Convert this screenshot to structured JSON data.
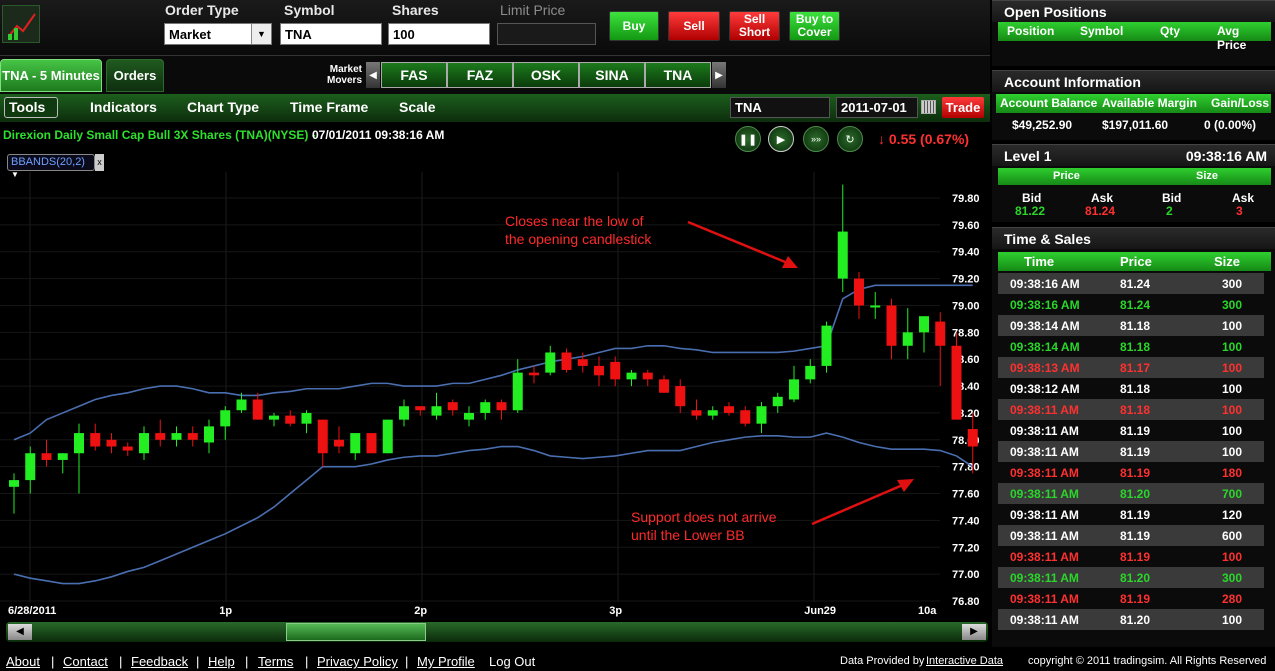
{
  "order": {
    "order_type_label": "Order Type",
    "order_type_value": "Market",
    "symbol_label": "Symbol",
    "symbol_value": "TNA",
    "shares_label": "Shares",
    "shares_value": "100",
    "limit_price_label": "Limit Price",
    "limit_price_value": "",
    "buy": "Buy",
    "sell": "Sell",
    "sell_short": "Sell Short",
    "buy_to_cover": "Buy to Cover"
  },
  "tabs": {
    "chart_tab": "TNA - 5 Minutes",
    "orders_tab": "Orders"
  },
  "market_movers": {
    "label": "Market Movers",
    "symbols": [
      "FAS",
      "FAZ",
      "OSK",
      "SINA",
      "TNA"
    ]
  },
  "toolbar": {
    "tools": "Tools",
    "indicators": "Indicators",
    "chart_type": "Chart Type",
    "time_frame": "Time Frame",
    "scale": "Scale",
    "symbol_input": "TNA",
    "date_input": "2011-07-01",
    "trade": "Trade"
  },
  "chart_header": {
    "title": "Direxion Daily Small Cap Bull 3X Shares (TNA)(NYSE) -",
    "timestamp": "07/01/2011 09:38:16 AM",
    "change": "↓ 0.55 (0.67%)",
    "indicator_tag": "BBANDS(20,2)"
  },
  "annotations": {
    "top_line1": "Closes near the low of",
    "top_line2": "the opening candlestick",
    "bottom_line1": "Support does not arrive",
    "bottom_line2": "until the Lower BB"
  },
  "colors": {
    "up": "#22ee22",
    "down": "#ee1111",
    "band": "#4a6fb0",
    "accent_green": "#2ad62a",
    "accent_red": "#ff3030"
  },
  "chart_data": {
    "type": "candlestick",
    "title": "",
    "xlabel": "",
    "ylabel": "",
    "ylim": [
      76.8,
      79.8
    ],
    "y_ticks": [
      "79.80",
      "79.60",
      "79.40",
      "79.20",
      "79.00",
      "78.80",
      "78.60",
      "78.40",
      "78.20",
      "78.00",
      "77.80",
      "77.60",
      "77.40",
      "77.20",
      "77.00",
      "76.80"
    ],
    "x_tick_labels": [
      {
        "index": 0,
        "label": "6/28/2011"
      },
      {
        "index": 13,
        "label": "1p"
      },
      {
        "index": 25,
        "label": "2p"
      },
      {
        "index": 37,
        "label": "3p"
      },
      {
        "index": 49,
        "label": "Jun29"
      },
      {
        "index": 56,
        "label": "10a"
      }
    ],
    "candles": [
      [
        77.65,
        77.75,
        77.45,
        77.7
      ],
      [
        77.7,
        77.95,
        77.6,
        77.9
      ],
      [
        77.9,
        78.0,
        77.8,
        77.85
      ],
      [
        77.85,
        77.9,
        77.75,
        77.9
      ],
      [
        77.9,
        78.12,
        77.6,
        78.05
      ],
      [
        78.05,
        78.12,
        77.92,
        77.95
      ],
      [
        78.0,
        78.05,
        77.9,
        77.95
      ],
      [
        77.95,
        77.98,
        77.88,
        77.92
      ],
      [
        77.9,
        78.1,
        77.85,
        78.05
      ],
      [
        78.05,
        78.15,
        77.95,
        78.0
      ],
      [
        78.0,
        78.1,
        77.95,
        78.05
      ],
      [
        78.05,
        78.1,
        77.95,
        78.0
      ],
      [
        77.98,
        78.15,
        77.9,
        78.1
      ],
      [
        78.1,
        78.25,
        78.0,
        78.22
      ],
      [
        78.22,
        78.35,
        78.2,
        78.3
      ],
      [
        78.3,
        78.35,
        78.15,
        78.15
      ],
      [
        78.15,
        78.2,
        78.1,
        78.18
      ],
      [
        78.18,
        78.22,
        78.1,
        78.12
      ],
      [
        78.12,
        78.22,
        78.05,
        78.2
      ],
      [
        78.15,
        78.15,
        77.8,
        77.9
      ],
      [
        78.0,
        78.1,
        77.9,
        77.95
      ],
      [
        77.9,
        78.05,
        77.85,
        78.05
      ],
      [
        78.05,
        78.05,
        77.9,
        77.9
      ],
      [
        77.9,
        78.15,
        77.9,
        78.15
      ],
      [
        78.15,
        78.3,
        78.1,
        78.25
      ],
      [
        78.25,
        78.25,
        78.18,
        78.22
      ],
      [
        78.18,
        78.35,
        78.15,
        78.25
      ],
      [
        78.28,
        78.3,
        78.18,
        78.22
      ],
      [
        78.15,
        78.25,
        78.1,
        78.2
      ],
      [
        78.2,
        78.3,
        78.15,
        78.28
      ],
      [
        78.28,
        78.3,
        78.15,
        78.22
      ],
      [
        78.22,
        78.6,
        78.2,
        78.5
      ],
      [
        78.5,
        78.55,
        78.42,
        78.48
      ],
      [
        78.5,
        78.7,
        78.48,
        78.65
      ],
      [
        78.65,
        78.68,
        78.5,
        78.52
      ],
      [
        78.6,
        78.65,
        78.5,
        78.55
      ],
      [
        78.55,
        78.62,
        78.4,
        78.48
      ],
      [
        78.58,
        78.62,
        78.4,
        78.45
      ],
      [
        78.45,
        78.52,
        78.4,
        78.5
      ],
      [
        78.5,
        78.52,
        78.4,
        78.45
      ],
      [
        78.45,
        78.48,
        78.35,
        78.35
      ],
      [
        78.4,
        78.45,
        78.2,
        78.25
      ],
      [
        78.22,
        78.3,
        78.15,
        78.18
      ],
      [
        78.18,
        78.25,
        78.15,
        78.22
      ],
      [
        78.25,
        78.28,
        78.18,
        78.2
      ],
      [
        78.22,
        78.25,
        78.1,
        78.12
      ],
      [
        78.12,
        78.28,
        78.05,
        78.25
      ],
      [
        78.25,
        78.35,
        78.2,
        78.32
      ],
      [
        78.3,
        78.55,
        78.28,
        78.45
      ],
      [
        78.45,
        78.6,
        78.42,
        78.55
      ],
      [
        78.55,
        78.88,
        78.5,
        78.85
      ],
      [
        79.2,
        79.9,
        79.1,
        79.55
      ],
      [
        79.2,
        79.25,
        78.9,
        79.0
      ],
      [
        79.0,
        79.1,
        78.9,
        79.0
      ],
      [
        79.0,
        79.05,
        78.6,
        78.7
      ],
      [
        78.7,
        78.98,
        78.6,
        78.8
      ],
      [
        78.8,
        78.92,
        78.65,
        78.92
      ],
      [
        78.88,
        78.95,
        78.4,
        78.7
      ],
      [
        78.7,
        78.8,
        78.15,
        78.15
      ],
      [
        78.08,
        78.2,
        77.75,
        77.95
      ]
    ],
    "bb_upper": [
      78.0,
      78.05,
      78.15,
      78.2,
      78.25,
      78.3,
      78.33,
      78.35,
      78.38,
      78.4,
      78.4,
      78.38,
      78.35,
      78.35,
      78.33,
      78.33,
      78.35,
      78.36,
      78.38,
      78.38,
      78.38,
      78.4,
      78.42,
      78.42,
      78.4,
      78.4,
      78.4,
      78.42,
      78.42,
      78.45,
      78.48,
      78.52,
      78.55,
      78.58,
      78.6,
      78.62,
      78.65,
      78.68,
      78.68,
      78.7,
      78.7,
      78.68,
      78.67,
      78.65,
      78.65,
      78.65,
      78.65,
      78.65,
      78.66,
      78.68,
      78.7,
      79.05,
      79.12,
      79.15,
      79.15,
      79.15,
      79.15,
      79.15,
      79.15,
      79.15
    ],
    "bb_lower": [
      77.0,
      76.97,
      76.95,
      76.93,
      76.93,
      76.95,
      76.98,
      77.02,
      77.05,
      77.1,
      77.15,
      77.2,
      77.25,
      77.3,
      77.36,
      77.42,
      77.5,
      77.6,
      77.7,
      77.8,
      77.8,
      77.8,
      77.82,
      77.85,
      77.87,
      77.88,
      77.88,
      77.9,
      77.92,
      77.93,
      77.95,
      77.95,
      77.92,
      77.88,
      77.87,
      77.86,
      77.87,
      77.88,
      77.9,
      77.92,
      77.92,
      77.92,
      77.95,
      77.98,
      78.0,
      78.02,
      78.03,
      78.03,
      78.02,
      78.02,
      78.05,
      78.02,
      77.98,
      77.95,
      77.93,
      77.93,
      77.93,
      77.92,
      77.88,
      77.8
    ]
  },
  "open_positions": {
    "title": "Open Positions",
    "headers": [
      "Position",
      "Symbol",
      "Qty",
      "Avg Price"
    ]
  },
  "account": {
    "title": "Account Information",
    "headers": [
      "Account Balance",
      "Available Margin",
      "Gain/Loss"
    ],
    "values": [
      "$49,252.90",
      "$197,011.60",
      "0 (0.00%)"
    ]
  },
  "level1": {
    "title": "Level 1",
    "time": "09:38:16 AM",
    "group_headers": [
      "Price",
      "Size"
    ],
    "sub_headers": [
      "Bid",
      "Ask",
      "Bid",
      "Ask"
    ],
    "values": [
      "81.22",
      "81.24",
      "2",
      "3"
    ]
  },
  "time_sales": {
    "title": "Time & Sales",
    "headers": [
      "Time",
      "Price",
      "Size"
    ],
    "rows": [
      [
        "09:38:16 AM",
        "81.24",
        "300",
        "w"
      ],
      [
        "09:38:16 AM",
        "81.24",
        "300",
        "g"
      ],
      [
        "09:38:14 AM",
        "81.18",
        "100",
        "w"
      ],
      [
        "09:38:14 AM",
        "81.18",
        "100",
        "g"
      ],
      [
        "09:38:13 AM",
        "81.17",
        "100",
        "r"
      ],
      [
        "09:38:12 AM",
        "81.18",
        "100",
        "w"
      ],
      [
        "09:38:11 AM",
        "81.18",
        "100",
        "r"
      ],
      [
        "09:38:11 AM",
        "81.19",
        "100",
        "w"
      ],
      [
        "09:38:11 AM",
        "81.19",
        "100",
        "w"
      ],
      [
        "09:38:11 AM",
        "81.19",
        "180",
        "r"
      ],
      [
        "09:38:11 AM",
        "81.20",
        "700",
        "g"
      ],
      [
        "09:38:11 AM",
        "81.19",
        "120",
        "w"
      ],
      [
        "09:38:11 AM",
        "81.19",
        "600",
        "w"
      ],
      [
        "09:38:11 AM",
        "81.19",
        "100",
        "r"
      ],
      [
        "09:38:11 AM",
        "81.20",
        "300",
        "g"
      ],
      [
        "09:38:11 AM",
        "81.19",
        "280",
        "r"
      ],
      [
        "09:38:11 AM",
        "81.20",
        "100",
        "w"
      ]
    ]
  },
  "footer": {
    "links": [
      "About",
      "Contact",
      "Feedback",
      "Help",
      "Terms",
      "Privacy Policy",
      "My Profile"
    ],
    "logout": "Log Out",
    "data_provided": "Data Provided by",
    "data_provider": "Interactive Data",
    "copyright": "copyright © 2011 tradingsim. All Rights Reserved"
  }
}
